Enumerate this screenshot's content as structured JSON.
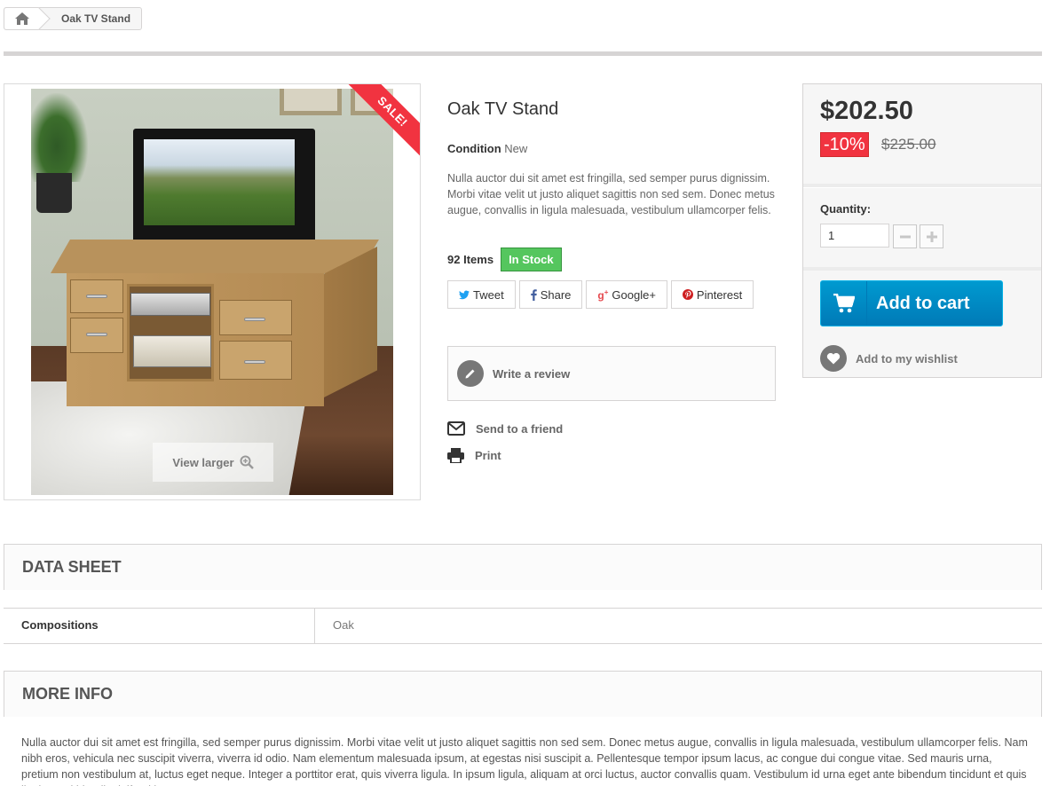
{
  "breadcrumb": {
    "home_icon": "home-icon",
    "current": "Oak TV Stand"
  },
  "image": {
    "sale_label": "SALE!",
    "view_larger": "View larger"
  },
  "product": {
    "title": "Oak TV Stand",
    "condition_label": "Condition",
    "condition_value": "New",
    "short_description": "Nulla auctor dui sit amet est fringilla, sed semper purus dignissim. Morbi vitae velit ut justo aliquet sagittis non sed sem. Donec metus augue, convallis in ligula malesuada, vestibulum ullamcorper felis.",
    "quantity": "92",
    "items_label": "Items",
    "availability": "In Stock"
  },
  "social": [
    {
      "label": "Tweet",
      "icon": "twitter-icon"
    },
    {
      "label": "Share",
      "icon": "facebook-icon"
    },
    {
      "label": "Google+",
      "icon": "google-plus-icon"
    },
    {
      "label": "Pinterest",
      "icon": "pinterest-icon"
    }
  ],
  "links": {
    "write_review": "Write a review",
    "send_friend": "Send to a friend",
    "print": "Print"
  },
  "buy": {
    "price": "$202.50",
    "discount": "-10%",
    "old_price": "$225.00",
    "quantity_label": "Quantity:",
    "quantity_value": "1",
    "add_to_cart": "Add to cart",
    "wishlist": "Add to my wishlist"
  },
  "data_sheet": {
    "heading": "DATA SHEET",
    "rows": [
      {
        "key": "Compositions",
        "value": "Oak"
      }
    ]
  },
  "more_info": {
    "heading": "MORE INFO",
    "text": "Nulla auctor dui sit amet est fringilla, sed semper purus dignissim. Morbi vitae velit ut justo aliquet sagittis non sed sem. Donec metus augue, convallis in ligula malesuada, vestibulum ullamcorper felis. Nam nibh eros, vehicula nec suscipit viverra, viverra id odio. Nam elementum malesuada ipsum, at egestas nisi suscipit a. Pellentesque tempor ipsum lacus, ac congue dui congue vitae. Sed mauris urna, pretium non vestibulum at, luctus eget neque. Integer a porttitor erat, quis viverra ligula. In ipsum ligula, aliquam at orci luctus, auctor convallis quam. Vestibulum id urna eget ante bibendum tincidunt et quis ligula. Sed blandit eleifend ipsum."
  },
  "colors": {
    "accent": "#f13340",
    "stock": "#55c65e",
    "cart": "#009ad0"
  }
}
